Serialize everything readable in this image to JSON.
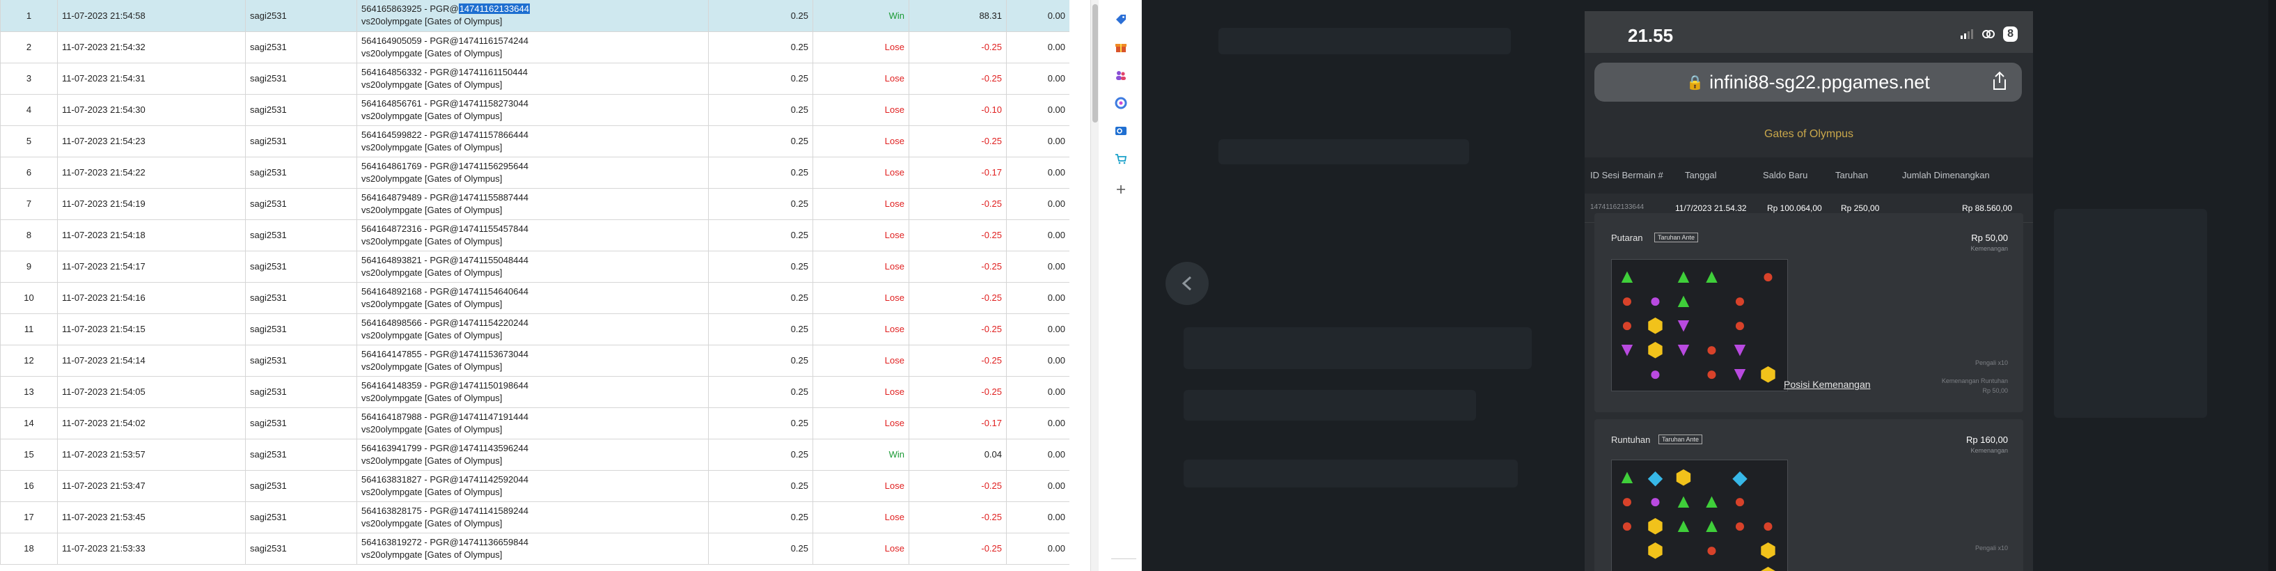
{
  "rows": [
    {
      "no": "1",
      "time": "11-07-2023 21:54:58",
      "user": "sagi2531",
      "round_prefix": "564165863925 - PGR@",
      "round_hl": "14741162133644",
      "game": "vs20olympgate [Gates of Olympus]",
      "bet": "0.25",
      "result": "Win",
      "profit": "88.31",
      "balance": "0.00"
    },
    {
      "no": "2",
      "time": "11-07-2023 21:54:32",
      "user": "sagi2531",
      "round_prefix": "564164905059 - PGR@14741161574244",
      "round_hl": "",
      "game": "vs20olympgate [Gates of Olympus]",
      "bet": "0.25",
      "result": "Lose",
      "profit": "-0.25",
      "balance": "0.00"
    },
    {
      "no": "3",
      "time": "11-07-2023 21:54:31",
      "user": "sagi2531",
      "round_prefix": "564164856332 - PGR@14741161150444",
      "round_hl": "",
      "game": "vs20olympgate [Gates of Olympus]",
      "bet": "0.25",
      "result": "Lose",
      "profit": "-0.25",
      "balance": "0.00"
    },
    {
      "no": "4",
      "time": "11-07-2023 21:54:30",
      "user": "sagi2531",
      "round_prefix": "564164856761 - PGR@14741158273044",
      "round_hl": "",
      "game": "vs20olympgate [Gates of Olympus]",
      "bet": "0.25",
      "result": "Lose",
      "profit": "-0.10",
      "balance": "0.00"
    },
    {
      "no": "5",
      "time": "11-07-2023 21:54:23",
      "user": "sagi2531",
      "round_prefix": "564164599822 - PGR@14741157866444",
      "round_hl": "",
      "game": "vs20olympgate [Gates of Olympus]",
      "bet": "0.25",
      "result": "Lose",
      "profit": "-0.25",
      "balance": "0.00"
    },
    {
      "no": "6",
      "time": "11-07-2023 21:54:22",
      "user": "sagi2531",
      "round_prefix": "564164861769 - PGR@14741156295644",
      "round_hl": "",
      "game": "vs20olympgate [Gates of Olympus]",
      "bet": "0.25",
      "result": "Lose",
      "profit": "-0.17",
      "balance": "0.00"
    },
    {
      "no": "7",
      "time": "11-07-2023 21:54:19",
      "user": "sagi2531",
      "round_prefix": "564164879489 - PGR@14741155887444",
      "round_hl": "",
      "game": "vs20olympgate [Gates of Olympus]",
      "bet": "0.25",
      "result": "Lose",
      "profit": "-0.25",
      "balance": "0.00"
    },
    {
      "no": "8",
      "time": "11-07-2023 21:54:18",
      "user": "sagi2531",
      "round_prefix": "564164872316 - PGR@14741155457844",
      "round_hl": "",
      "game": "vs20olympgate [Gates of Olympus]",
      "bet": "0.25",
      "result": "Lose",
      "profit": "-0.25",
      "balance": "0.00"
    },
    {
      "no": "9",
      "time": "11-07-2023 21:54:17",
      "user": "sagi2531",
      "round_prefix": "564164893821 - PGR@14741155048444",
      "round_hl": "",
      "game": "vs20olympgate [Gates of Olympus]",
      "bet": "0.25",
      "result": "Lose",
      "profit": "-0.25",
      "balance": "0.00"
    },
    {
      "no": "10",
      "time": "11-07-2023 21:54:16",
      "user": "sagi2531",
      "round_prefix": "564164892168 - PGR@14741154640644",
      "round_hl": "",
      "game": "vs20olympgate [Gates of Olympus]",
      "bet": "0.25",
      "result": "Lose",
      "profit": "-0.25",
      "balance": "0.00"
    },
    {
      "no": "11",
      "time": "11-07-2023 21:54:15",
      "user": "sagi2531",
      "round_prefix": "564164898566 - PGR@14741154220244",
      "round_hl": "",
      "game": "vs20olympgate [Gates of Olympus]",
      "bet": "0.25",
      "result": "Lose",
      "profit": "-0.25",
      "balance": "0.00"
    },
    {
      "no": "12",
      "time": "11-07-2023 21:54:14",
      "user": "sagi2531",
      "round_prefix": "564164147855 - PGR@14741153673044",
      "round_hl": "",
      "game": "vs20olympgate [Gates of Olympus]",
      "bet": "0.25",
      "result": "Lose",
      "profit": "-0.25",
      "balance": "0.00"
    },
    {
      "no": "13",
      "time": "11-07-2023 21:54:05",
      "user": "sagi2531",
      "round_prefix": "564164148359 - PGR@14741150198644",
      "round_hl": "",
      "game": "vs20olympgate [Gates of Olympus]",
      "bet": "0.25",
      "result": "Lose",
      "profit": "-0.25",
      "balance": "0.00"
    },
    {
      "no": "14",
      "time": "11-07-2023 21:54:02",
      "user": "sagi2531",
      "round_prefix": "564164187988 - PGR@14741147191444",
      "round_hl": "",
      "game": "vs20olympgate [Gates of Olympus]",
      "bet": "0.25",
      "result": "Lose",
      "profit": "-0.17",
      "balance": "0.00"
    },
    {
      "no": "15",
      "time": "11-07-2023 21:53:57",
      "user": "sagi2531",
      "round_prefix": "564163941799 - PGR@14741143596244",
      "round_hl": "",
      "game": "vs20olympgate [Gates of Olympus]",
      "bet": "0.25",
      "result": "Win",
      "profit": "0.04",
      "balance": "0.00"
    },
    {
      "no": "16",
      "time": "11-07-2023 21:53:47",
      "user": "sagi2531",
      "round_prefix": "564163831827 - PGR@14741142592044",
      "round_hl": "",
      "game": "vs20olympgate [Gates of Olympus]",
      "bet": "0.25",
      "result": "Lose",
      "profit": "-0.25",
      "balance": "0.00"
    },
    {
      "no": "17",
      "time": "11-07-2023 21:53:45",
      "user": "sagi2531",
      "round_prefix": "564163828175 - PGR@14741141589244",
      "round_hl": "",
      "game": "vs20olympgate [Gates of Olympus]",
      "bet": "0.25",
      "result": "Lose",
      "profit": "-0.25",
      "balance": "0.00"
    },
    {
      "no": "18",
      "time": "11-07-2023 21:53:33",
      "user": "sagi2531",
      "round_prefix": "564163819272 - PGR@14741136659844",
      "round_hl": "",
      "game": "vs20olympgate [Gates of Olympus]",
      "bet": "0.25",
      "result": "Lose",
      "profit": "-0.25",
      "balance": "0.00"
    }
  ],
  "colors": {
    "win": "#1c9a35",
    "lose": "#e02020",
    "selected_row": "#cfe8ef",
    "dark_bg": "#1b1f23",
    "gold": "#c9a74b"
  },
  "icon_strip": [
    "tag-icon",
    "gift-icon",
    "people-icon",
    "copilot-icon",
    "outlook-icon",
    "shopping-cart-icon",
    "plus-icon"
  ],
  "phone": {
    "clock": "21.55",
    "battery": "8",
    "url": "infini88-sg22.ppgames.net",
    "game_title": "Gates of Olympus",
    "headers": {
      "session": "ID Sesi Bermain #",
      "date": "Tanggal",
      "new_balance": "Saldo Baru",
      "bet": "Taruhan",
      "win_total": "Jumlah Dimenangkan"
    },
    "summary": {
      "session": "14741162133644",
      "date": "11/7/2023 21.54.32",
      "new_balance": "Rp 100.064,00",
      "bet": "Rp 250,00",
      "win_total": "Rp 88.560,00"
    },
    "spin_panel": {
      "label": "Putaran",
      "tag": "Taruhan Ante",
      "amount": "Rp 50,00",
      "amount_sub": "Kemenangan",
      "mult_label": "Pengali x10",
      "win_label": "Kemenangan Runtuhan",
      "win_value": "Rp 50,00",
      "link": "Posisi Kemenangan"
    },
    "tumble_panel": {
      "label": "Runtuhan",
      "tag": "Taruhan Ante",
      "amount": "Rp 160,00",
      "amount_sub": "Kemenangan",
      "mult_label": "Pengali x10"
    }
  }
}
